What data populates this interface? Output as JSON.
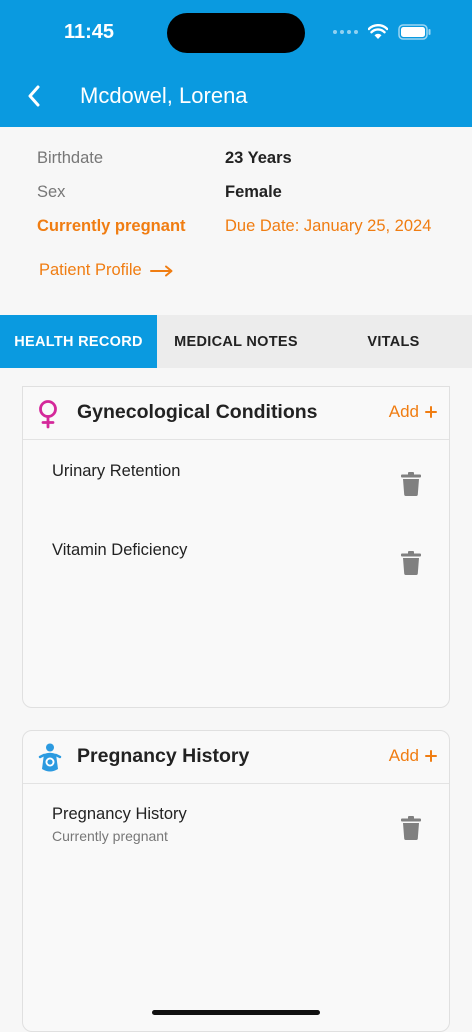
{
  "status": {
    "time": "11:45"
  },
  "header": {
    "title": "Mcdowel, Lorena"
  },
  "patient": {
    "birthdate_label": "Birthdate",
    "birthdate_value": "23 Years",
    "sex_label": "Sex",
    "sex_value": "Female",
    "pregnant_label": "Currently pregnant",
    "due_date": "Due Date: January 25, 2024",
    "profile_link": "Patient Profile"
  },
  "tabs": [
    {
      "label": "HEALTH RECORD",
      "active": true
    },
    {
      "label": "MEDICAL NOTES",
      "active": false
    },
    {
      "label": "VITALS",
      "active": false
    }
  ],
  "cards": {
    "gyno": {
      "title": "Gynecological Conditions",
      "add_label": "Add",
      "items": [
        {
          "title": "Urinary Retention"
        },
        {
          "title": "Vitamin Deficiency"
        }
      ]
    },
    "pregnancy": {
      "title": "Pregnancy History",
      "add_label": "Add",
      "items": [
        {
          "title": "Pregnancy History",
          "subtitle": "Currently pregnant"
        }
      ]
    }
  },
  "colors": {
    "primary": "#0a9ae0",
    "accent": "#f07d12",
    "female_icon": "#d4289a"
  },
  "icons": [
    "back-arrow-icon",
    "arrow-right-icon",
    "female-symbol-icon",
    "pregnant-icon",
    "plus-icon",
    "trash-icon",
    "wifi-icon",
    "battery-icon"
  ]
}
